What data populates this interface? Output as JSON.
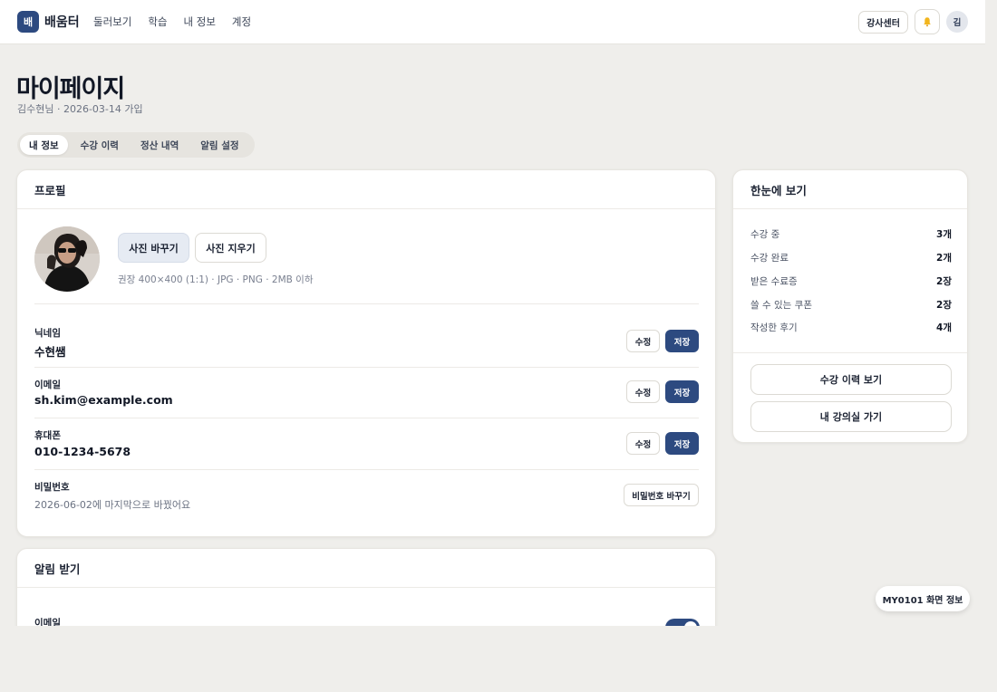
{
  "header": {
    "logo_glyph": "배",
    "brand": "배움터",
    "nav": [
      "둘러보기",
      "학습",
      "내 정보",
      "계정"
    ],
    "instructor_center": "강사센터",
    "avatar_initial": "김"
  },
  "page": {
    "title": "마이페이지",
    "subtitle": "김수현님 · 2026-03-14 가입",
    "tabs": [
      "내 정보",
      "수강 이력",
      "정산 내역",
      "알림 설정"
    ],
    "active_tab": "내 정보"
  },
  "profile": {
    "title": "프로필",
    "change_photo": "사진 바꾸기",
    "remove_photo": "사진 지우기",
    "photo_hint": "권장 400×400 (1:1) · JPG · PNG · 2MB 이하",
    "fields": [
      {
        "label": "닉네임",
        "value": "수현쌤",
        "edit": "수정",
        "save": "저장"
      },
      {
        "label": "이메일",
        "value": "sh.kim@example.com",
        "edit": "수정",
        "save": "저장"
      },
      {
        "label": "휴대폰",
        "value": "010-1234-5678",
        "edit": "수정",
        "save": "저장"
      }
    ],
    "password": {
      "label": "비밀번호",
      "value": "2026-06-02에 마지막으로 바꿨어요",
      "button": "비밀번호 바꾸기"
    }
  },
  "notifications": {
    "title": "알림 받기",
    "first_label": "이메일",
    "email_enabled": true
  },
  "summary": {
    "title": "한눈에 보기",
    "stats": [
      {
        "label": "수강 중",
        "value": "3개"
      },
      {
        "label": "수강 완료",
        "value": "2개"
      },
      {
        "label": "받은 수료증",
        "value": "2장"
      },
      {
        "label": "쓸 수 있는 쿠폰",
        "value": "2장"
      },
      {
        "label": "작성한 후기",
        "value": "4개"
      }
    ],
    "history_button": "수강 이력 보기",
    "classroom_button": "내 강의실 가기"
  },
  "screen_info": "MY0101 화면 정보",
  "colors": {
    "primary": "#2d4a80",
    "background": "#efeeeb",
    "card": "#ffffff"
  }
}
